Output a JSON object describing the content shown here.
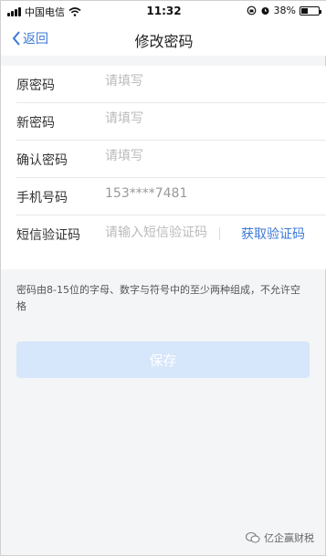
{
  "status_bar": {
    "carrier": "中国电信",
    "time": "11:32",
    "battery_percent": "38%",
    "battery_level": 0.38,
    "icons": [
      "signal-icon",
      "wifi-icon",
      "lock-rotation-icon",
      "alarm-icon",
      "battery-icon"
    ]
  },
  "nav": {
    "back_label": "返回",
    "title": "修改密码"
  },
  "form": {
    "old_password": {
      "label": "原密码",
      "placeholder": "请填写"
    },
    "new_password": {
      "label": "新密码",
      "placeholder": "请填写"
    },
    "confirm_password": {
      "label": "确认密码",
      "placeholder": "请填写"
    },
    "phone": {
      "label": "手机号码",
      "value": "153****7481"
    },
    "sms_code": {
      "label": "短信验证码",
      "placeholder": "请输入短信验证码",
      "get_code_label": "获取验证码"
    }
  },
  "hint": "密码由8-15位的字母、数字与符号中的至少两种组成，不允许空格",
  "save_label": "保存",
  "watermark": "亿企赢财税",
  "colors": {
    "accent": "#3b78d8",
    "button_disabled": "#d6e6fb",
    "background": "#f4f5f7"
  }
}
